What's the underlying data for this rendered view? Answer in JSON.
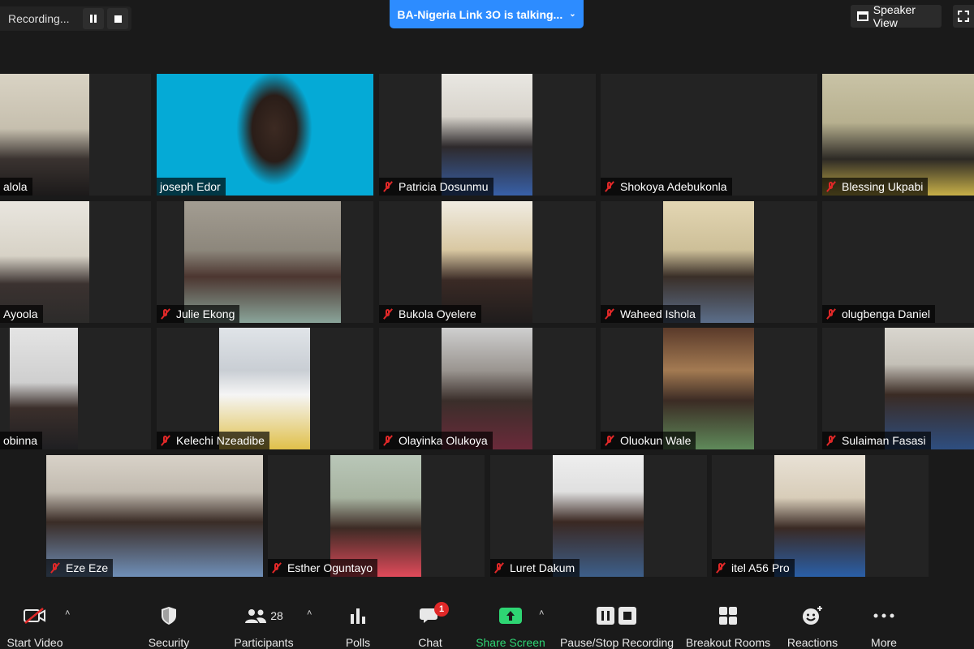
{
  "recording": {
    "status_text": "Recording..."
  },
  "banner": {
    "talking_text": "BA-Nigeria Link 3O is talking..."
  },
  "view": {
    "speaker_view_label": "Speaker View"
  },
  "participants": [
    {
      "name": "alola",
      "muted": false
    },
    {
      "name": "joseph Edor",
      "muted": false
    },
    {
      "name": "Patricia Dosunmu",
      "muted": true
    },
    {
      "name": "Shokoya Adebukonla",
      "muted": true
    },
    {
      "name": "Blessing Ukpabi",
      "muted": true
    },
    {
      "name": "Ayoola",
      "muted": false
    },
    {
      "name": "Julie Ekong",
      "muted": true
    },
    {
      "name": "Bukola Oyelere",
      "muted": true
    },
    {
      "name": "Waheed Ishola",
      "muted": true
    },
    {
      "name": "olugbenga Daniel",
      "muted": true
    },
    {
      "name": "obinna",
      "muted": false
    },
    {
      "name": "Kelechi Nzeadibe",
      "muted": true
    },
    {
      "name": "Olayinka Olukoya",
      "muted": true
    },
    {
      "name": "Oluokun Wale",
      "muted": true
    },
    {
      "name": "Sulaiman Fasasi",
      "muted": true
    },
    {
      "name": "Eze Eze",
      "muted": true
    },
    {
      "name": "Esther Oguntayo",
      "muted": true
    },
    {
      "name": "Luret Dakum",
      "muted": true
    },
    {
      "name": "itel A56 Pro",
      "muted": true
    }
  ],
  "toolbar": {
    "start_video": "Start Video",
    "security": "Security",
    "participants": "Participants",
    "participants_count": "28",
    "polls": "Polls",
    "chat": "Chat",
    "chat_badge": "1",
    "share_screen": "Share Screen",
    "pause_stop_recording": "Pause/Stop Recording",
    "breakout_rooms": "Breakout Rooms",
    "reactions": "Reactions",
    "more": "More"
  },
  "colors": {
    "accent_blue": "#2d8cff",
    "share_green": "#2ed573",
    "mute_red": "#e02828"
  }
}
